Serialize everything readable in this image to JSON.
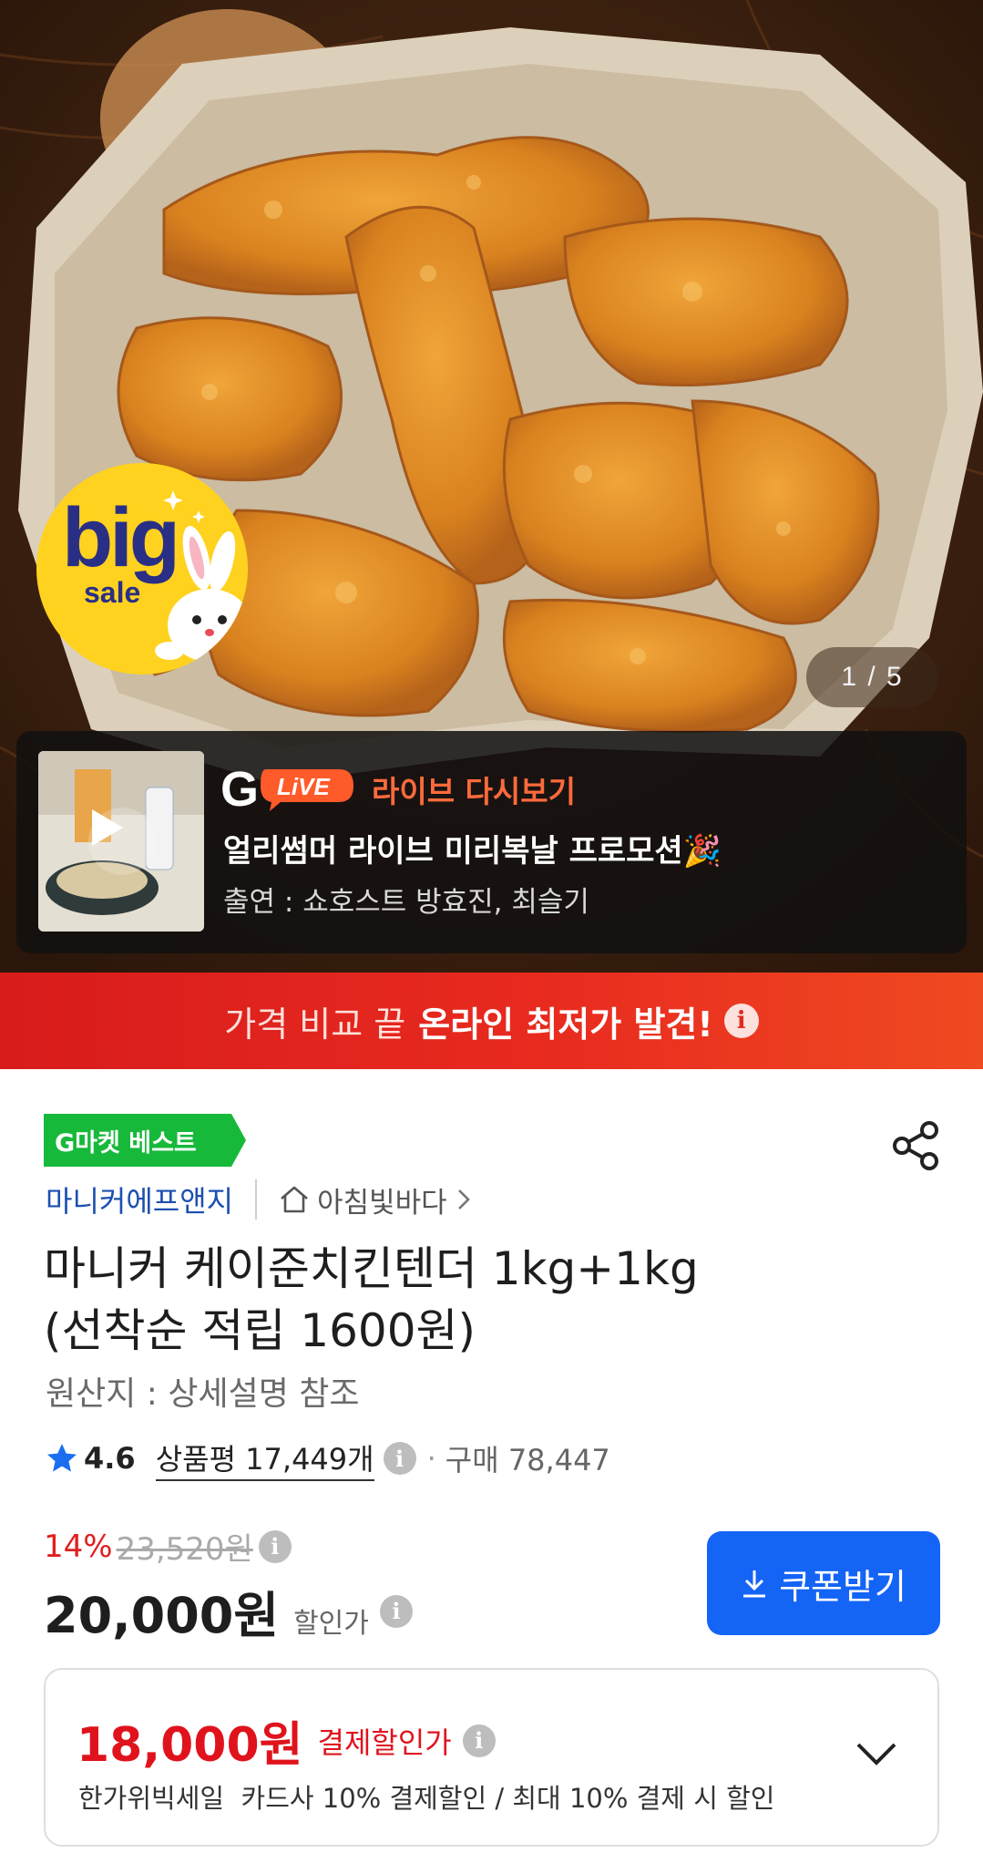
{
  "hero": {
    "badge_big": "big",
    "badge_sale": "sale",
    "counter": "1 / 5"
  },
  "live": {
    "logo_g": "G",
    "logo_live": "LiVE",
    "title": "라이브 다시보기",
    "promo": "얼리썸머 라이브 미리복날 프로모션🎉",
    "cast": "출연 : 쇼호스트 방효진, 최슬기"
  },
  "banner": {
    "light": "가격 비교 끝",
    "strong": "온라인 최저가 발견!",
    "info": "i"
  },
  "product": {
    "best_tag": "G마켓 베스트",
    "seller": "마니커에프앤지",
    "store": "아침빛바다",
    "title_line1": "마니커 케이준치킨텐더 1kg+1kg",
    "title_line2": "(선착순 적립 1600원)",
    "origin": "원산지 : 상세설명 참조",
    "rating": "4.6",
    "reviews": "상품평 17,449개",
    "purchases": "구매 78,447"
  },
  "price": {
    "discount_pct": "14%",
    "original": "23,520원",
    "sale": "20,000원",
    "sale_label": "할인가",
    "coupon_button": "쿠폰받기"
  },
  "payment": {
    "amount": "18,000원",
    "label": "결제할인가",
    "description": "한가위빅세일  카드사 10% 결제할인 / 최대 10% 결제 시 할인"
  },
  "colors": {
    "brand_red": "#e0131d",
    "coupon_blue": "#1464f6",
    "best_green": "#17b93a",
    "seller_blue": "#1d4fb0",
    "live_orange": "#ff6a3d",
    "star_blue": "#1a6ff0"
  },
  "icons": [
    "share-icon",
    "home-icon",
    "star-icon",
    "info-icon",
    "download-icon",
    "chevron-down-icon",
    "play-icon",
    "chevron-right-icon"
  ]
}
